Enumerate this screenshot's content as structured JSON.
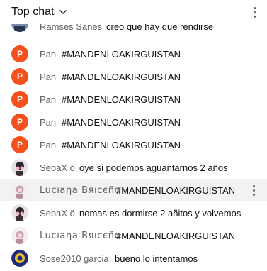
{
  "header": {
    "title": "Top chat"
  },
  "messages": [
    {
      "author": "Ramses Sanes",
      "text": "creo que hay que rendirse",
      "avatar": "photo"
    },
    {
      "author": "Pan",
      "text": "#MANDENLOAKIRGUISTAN",
      "avatar_letter": "P"
    },
    {
      "author": "Pan",
      "text": "#MANDENLOAKIRGUISTAN",
      "avatar_letter": "P"
    },
    {
      "author": "Pan",
      "text": "#MANDENLOAKIRGUISTAN",
      "avatar_letter": "P"
    },
    {
      "author": "Pan",
      "text": "#MANDENLOAKIRGUISTAN",
      "avatar_letter": "P"
    },
    {
      "author": "Pan",
      "text": "#MANDENLOAKIRGUISTAN",
      "avatar_letter": "P"
    },
    {
      "author": "SebaX ö",
      "text": "oye si podemos aguantarnos 2 años",
      "avatar": "photo"
    },
    {
      "author": "Lucıaηa Вяıcєñσ",
      "text": "#MANDENLOAKIRGUISTAN",
      "avatar": "photo"
    },
    {
      "author": "SebaX ö",
      "text": "nomas es dormirse 2 añitos y volvemos",
      "avatar": "photo"
    },
    {
      "author": "Lucıaηa Вяıcєñσ",
      "text": "#MANDENLOAKIRGUISTAN",
      "avatar": "photo"
    },
    {
      "author": "Sose2010 garcia",
      "text": "bueno lo intentamos",
      "avatar": "photo"
    }
  ],
  "colors": {
    "avatar_p": "#f4511e",
    "highlight": "#f2f2f2",
    "author": "#606060"
  }
}
